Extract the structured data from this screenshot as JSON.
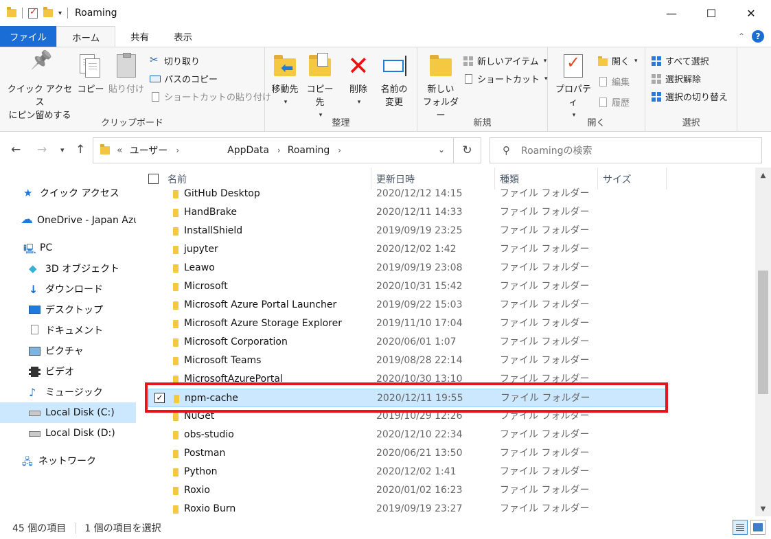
{
  "window": {
    "title": "Roaming",
    "minimize": "—",
    "maximize": "☐",
    "close": "✕"
  },
  "tabs": {
    "file": "ファイル",
    "home": "ホーム",
    "share": "共有",
    "view": "表示",
    "help": "?"
  },
  "ribbon": {
    "clipboard": {
      "label": "クリップボード",
      "pin_line1": "クイック アクセス",
      "pin_line2": "にピン留めする",
      "copy": "コピー",
      "paste": "貼り付け",
      "cut": "切り取り",
      "copy_path": "パスのコピー",
      "paste_shortcut": "ショートカットの貼り付け"
    },
    "organize": {
      "label": "整理",
      "move_to": "移動先",
      "copy_to": "コピー先",
      "delete": "削除",
      "rename_line1": "名前の",
      "rename_line2": "変更"
    },
    "new": {
      "label": "新規",
      "new_folder_line1": "新しい",
      "new_folder_line2": "フォルダー",
      "new_item": "新しいアイテム",
      "shortcut": "ショートカット"
    },
    "open": {
      "label": "開く",
      "properties": "プロパティ",
      "open": "開く",
      "edit": "編集",
      "history": "履歴"
    },
    "select": {
      "label": "選択",
      "select_all": "すべて選択",
      "select_none": "選択解除",
      "invert": "選択の切り替え"
    }
  },
  "address": {
    "overflow": "«",
    "segments": [
      "ユーザー",
      "AppData",
      "Roaming"
    ],
    "search_placeholder": "Roamingの検索"
  },
  "sidebar": {
    "items": [
      {
        "label": "クイック アクセス"
      },
      {
        "label": "OneDrive - Japan Azure User Group"
      },
      {
        "label": "PC"
      },
      {
        "label": "3D オブジェクト"
      },
      {
        "label": "ダウンロード"
      },
      {
        "label": "デスクトップ"
      },
      {
        "label": "ドキュメント"
      },
      {
        "label": "ピクチャ"
      },
      {
        "label": "ビデオ"
      },
      {
        "label": "ミュージック"
      },
      {
        "label": "Local Disk (C:)"
      },
      {
        "label": "Local Disk (D:)"
      },
      {
        "label": "ネットワーク"
      }
    ]
  },
  "columns": {
    "name": "名前",
    "date": "更新日時",
    "type": "種類",
    "size": "サイズ"
  },
  "files": [
    {
      "name": "GitHub Desktop",
      "date": "2020/12/12 14:15",
      "type": "ファイル フォルダー"
    },
    {
      "name": "HandBrake",
      "date": "2020/12/11 14:33",
      "type": "ファイル フォルダー"
    },
    {
      "name": "InstallShield",
      "date": "2019/09/19 23:25",
      "type": "ファイル フォルダー"
    },
    {
      "name": "jupyter",
      "date": "2020/12/02 1:42",
      "type": "ファイル フォルダー"
    },
    {
      "name": "Leawo",
      "date": "2019/09/19 23:08",
      "type": "ファイル フォルダー"
    },
    {
      "name": "Microsoft",
      "date": "2020/10/31 15:42",
      "type": "ファイル フォルダー"
    },
    {
      "name": "Microsoft Azure Portal Launcher",
      "date": "2019/09/22 15:03",
      "type": "ファイル フォルダー"
    },
    {
      "name": "Microsoft Azure Storage Explorer",
      "date": "2019/11/10 17:04",
      "type": "ファイル フォルダー"
    },
    {
      "name": "Microsoft Corporation",
      "date": "2020/06/01 1:07",
      "type": "ファイル フォルダー"
    },
    {
      "name": "Microsoft Teams",
      "date": "2019/08/28 22:14",
      "type": "ファイル フォルダー"
    },
    {
      "name": "MicrosoftAzurePortal",
      "date": "2020/10/30 13:10",
      "type": "ファイル フォルダー"
    },
    {
      "name": "npm-cache",
      "date": "2020/12/11 19:55",
      "type": "ファイル フォルダー",
      "selected": true
    },
    {
      "name": "NuGet",
      "date": "2019/10/29 12:26",
      "type": "ファイル フォルダー"
    },
    {
      "name": "obs-studio",
      "date": "2020/12/10 22:34",
      "type": "ファイル フォルダー"
    },
    {
      "name": "Postman",
      "date": "2020/06/21 13:50",
      "type": "ファイル フォルダー"
    },
    {
      "name": "Python",
      "date": "2020/12/02 1:41",
      "type": "ファイル フォルダー"
    },
    {
      "name": "Roxio",
      "date": "2020/01/02 16:23",
      "type": "ファイル フォルダー"
    },
    {
      "name": "Roxio Burn",
      "date": "2019/09/19 23:27",
      "type": "ファイル フォルダー"
    }
  ],
  "status": {
    "item_count": "45 個の項目",
    "selected_count": "1 個の項目を選択"
  },
  "colors": {
    "accent": "#1a6dd4",
    "selection": "#cce8ff",
    "highlight_box": "#e8141c"
  }
}
